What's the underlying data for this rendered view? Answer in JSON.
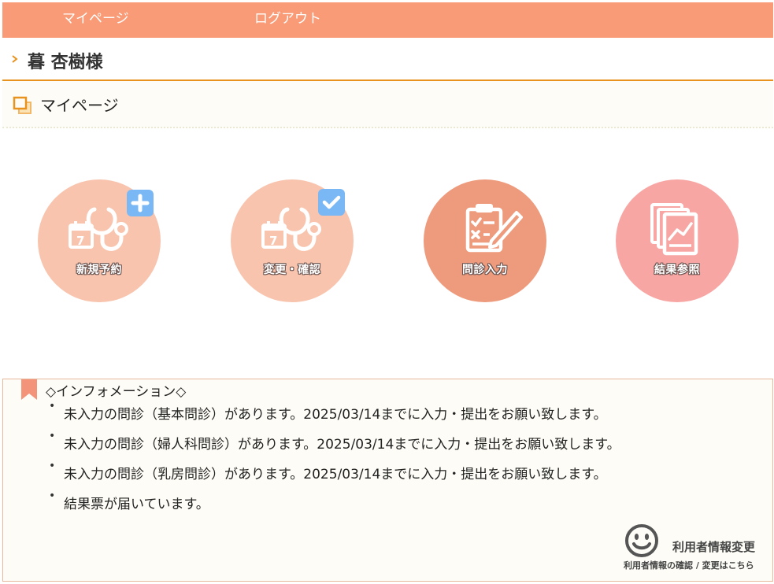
{
  "nav": {
    "mypage_label": "マイページ",
    "logout_label": "ログアウト"
  },
  "user": {
    "name": "暮 杏樹様"
  },
  "page": {
    "title": "マイページ"
  },
  "menu": [
    {
      "label": "新規予約",
      "icon": "stethoscope-calendar-icon",
      "badge": "plus-badge-icon",
      "color": "#f8c4ae"
    },
    {
      "label": "変更・確認",
      "icon": "stethoscope-calendar-icon",
      "badge": "check-badge-icon",
      "color": "#f8c4ae"
    },
    {
      "label": "問診入力",
      "icon": "clipboard-pen-icon",
      "color": "#ee9a7c"
    },
    {
      "label": "結果参照",
      "icon": "documents-chart-icon",
      "color": "#f8a6a4"
    }
  ],
  "info": {
    "title": "◇インフォメーション◇",
    "items": [
      "未入力の問診（基本問診）があります。2025/03/14までに入力・提出をお願い致します。",
      "未入力の問診（婦人科問診）があります。2025/03/14までに入力・提出をお願い致します。",
      "未入力の問診（乳房問診）があります。2025/03/14までに入力・提出をお願い致します。",
      "結果票が届いています。"
    ]
  },
  "profile": {
    "main_label": "利用者情報変更",
    "sub_label": "利用者情報の確認 / 変更はこちら"
  },
  "colors": {
    "topbar": "#f99b76",
    "accent_line": "#e89220",
    "badge_blue": "#7ab8f5"
  }
}
